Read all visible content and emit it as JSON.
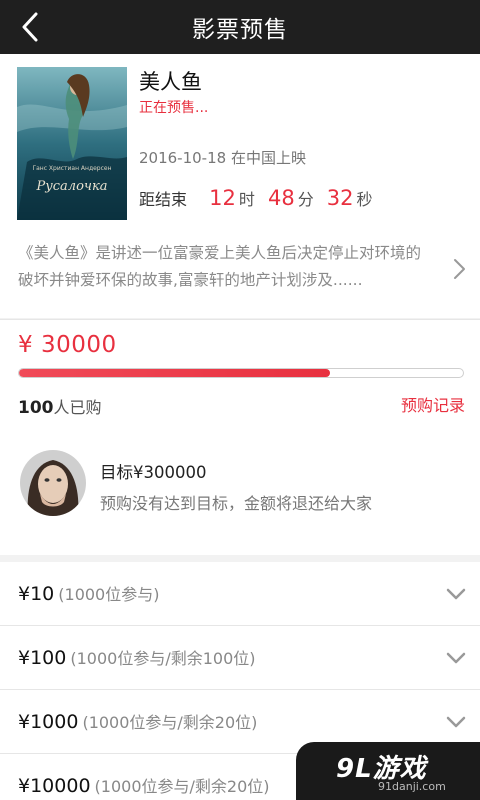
{
  "header": {
    "title": "影票预售"
  },
  "movie": {
    "title": "美人鱼",
    "status": "正在预售...",
    "release": "2016-10-18 在中国上映",
    "poster_author": "Ганс Христиан Андерсен",
    "poster_title": "Русалочка",
    "countdown": {
      "label": "距结束",
      "hours": "12",
      "hours_unit": "时",
      "minutes": "48",
      "minutes_unit": "分",
      "seconds": "32",
      "seconds_unit": "秒"
    },
    "description": "《美人鱼》是讲述一位富豪爱上美人鱼后决定停止对环境的破坏并钟爱环保的故事,富豪轩的地产计划涉及......"
  },
  "funding": {
    "amount": "¥ 30000",
    "progress": 0.7,
    "buyers_count": "100",
    "buyers_suffix": "人已购",
    "records_link": "预购记录",
    "goal": "目标¥300000",
    "note": "预购没有达到目标，金额将退还给大家"
  },
  "tiers": [
    {
      "price": "¥10",
      "detail": "(1000位参与)"
    },
    {
      "price": "¥100",
      "detail": "(1000位参与/剩余100位)"
    },
    {
      "price": "¥1000",
      "detail": "(1000位参与/剩余20位)"
    },
    {
      "price": "¥10000",
      "detail": "(1000位参与/剩余20位)"
    }
  ],
  "watermark": {
    "main": "9L游戏",
    "sub": "91danji.com"
  },
  "colors": {
    "accent": "#e8303f",
    "topbar": "#1f1f1f"
  },
  "icons": {
    "back": "back-arrow-icon",
    "more": "chevron-right-icon",
    "expand": "chevron-down-icon"
  }
}
